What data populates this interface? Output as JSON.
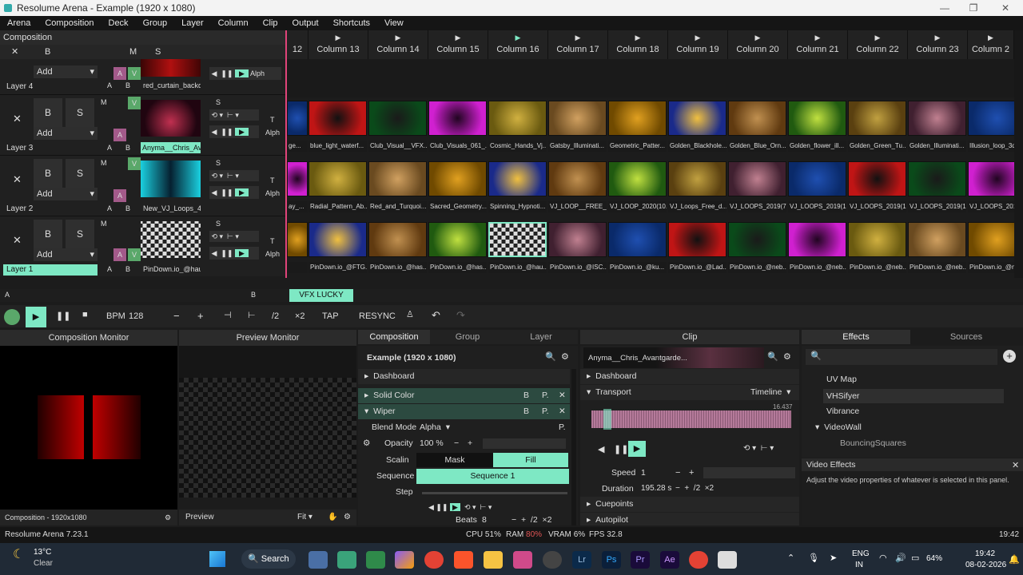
{
  "window": {
    "title": "Resolume Arena - Example (1920 x 1080)"
  },
  "menu": [
    "Arena",
    "Composition",
    "Deck",
    "Group",
    "Layer",
    "Column",
    "Clip",
    "Output",
    "Shortcuts",
    "View"
  ],
  "composition_label": "Composition",
  "columns": [
    "12",
    "Column 13",
    "Column 14",
    "Column 15",
    "Column 16",
    "Column 17",
    "Column 18",
    "Column 19",
    "Column 20",
    "Column 21",
    "Column 22",
    "Column 23",
    "Column 2"
  ],
  "layers": [
    {
      "name": "Layer 4",
      "clip": "red_curtain_backd...",
      "add": "Add"
    },
    {
      "name": "Layer 3",
      "clip": "Anyma__Chris_Av...",
      "add": "Add"
    },
    {
      "name": "Layer 2",
      "clip": "New_VJ_Loops_4K_...",
      "add": "Add"
    },
    {
      "name": "Layer 1",
      "clip": "PinDown.io_@hau...",
      "add": "Add"
    }
  ],
  "layer_letters": {
    "a": "A",
    "b": "B",
    "s": "S",
    "m": "M",
    "v": "V",
    "t": "T",
    "alph": "Alph",
    "x": "✕"
  },
  "clips_row3": [
    "ge...",
    "blue_light_waterf...",
    "Club_Visual__VFX...",
    "Club_Visuals_061_...",
    "Cosmic_Hands_Vj...",
    "Gatsby_Illuminati...",
    "Geometric_Patter...",
    "Golden_Blackhole...",
    "Golden_Blue_Orn...",
    "Golden_flower_ill...",
    "Golden_Green_Tu...",
    "Golden_Illuminati...",
    "Illusion_loop_3d"
  ],
  "clips_row2": [
    "ay_...",
    "Radial_Pattern_Ab...",
    "Red_and_Turquoi...",
    "Sacred_Geometry...",
    "Spinning_Hypnoti...",
    "VJ_LOOP__FREE_...",
    "VJ_LOOP_2020(10...",
    "VJ_Loops_Free_d...",
    "VJ_LOOPS_2019(7...",
    "VJ_LOOPS_2019(1...",
    "VJ_LOOPS_2019(1...",
    "VJ_LOOPS_2019(1...",
    "VJ_LOOPS_2019(1"
  ],
  "clips_row1": [
    "",
    "PinDown.io_@FTG...",
    "PinDown.io_@has...",
    "PinDown.io_@has...",
    "PinDown.io_@hau...",
    "PinDown.io_@ISC...",
    "PinDown.io_@ku...",
    "PinDown.io_@Lad...",
    "PinDown.io_@neb...",
    "PinDown.io_@neb...",
    "PinDown.io_@neb...",
    "PinDown.io_@neb...",
    "PinDown.io_@neb"
  ],
  "deck": {
    "name": "VFX LUCKY",
    "a": "A",
    "b": "B"
  },
  "transport": {
    "bpm_label": "BPM",
    "bpm": "128",
    "minus": "−",
    "plus": "+",
    "half": "/2",
    "double": "×2",
    "tap": "TAP",
    "resync": "RESYNC"
  },
  "comp_monitor": {
    "title": "Composition Monitor",
    "footer": "Composition - 1920x1080"
  },
  "preview_monitor": {
    "title": "Preview Monitor",
    "footer": "Preview",
    "fit": "Fit"
  },
  "comp_panel": {
    "tabs": [
      "Composition",
      "Group",
      "Layer"
    ],
    "title": "Example (1920 x 1080)",
    "dashboard": "Dashboard",
    "effects": [
      "Solid Color",
      "Wiper"
    ],
    "blend_label": "Blend Mode",
    "blend_value": "Alpha",
    "opacity_label": "Opacity",
    "opacity_value": "100 %",
    "scaling_label": "Scalin",
    "mask": "Mask",
    "fill": "Fill",
    "sequence_label": "Sequence",
    "sequence_value": "Sequence 1",
    "step_label": "Step",
    "beats_label": "Beats",
    "beats_value": "8"
  },
  "clip_panel": {
    "tab": "Clip",
    "name": "Anyma__Chris_Avantgarde...",
    "dashboard": "Dashboard",
    "transport": "Transport",
    "timeline": "Timeline",
    "time": "16.437",
    "speed_label": "Speed",
    "speed_value": "1",
    "duration_label": "Duration",
    "duration_value": "195.28 s",
    "cuepoints": "Cuepoints",
    "autopilot": "Autopilot"
  },
  "effects_panel": {
    "tabs": [
      "Effects",
      "Sources"
    ],
    "items": [
      "UV Map",
      "VHSifyer",
      "Vibrance",
      "VideoWall",
      "BouncingSquares"
    ],
    "info_title": "Video Effects",
    "info_text": "Adjust the video properties of whatever is selected in this panel."
  },
  "status": {
    "version": "Resolume Arena 7.23.1",
    "cpu_label": "CPU",
    "cpu": "51%",
    "ram_label": "RAM",
    "ram": "80%",
    "vram_label": "VRAM",
    "vram": "6%",
    "fps_label": "FPS",
    "fps": "32.8",
    "time": "19:42"
  },
  "taskbar": {
    "temp": "13°C",
    "weather": "Clear",
    "search": "Search",
    "lang1": "ENG",
    "lang2": "IN",
    "battery": "64%",
    "clock": "19:42",
    "date": "08-02-2026"
  },
  "colors": {
    "accent": "#7ee8c4",
    "bg": "#1c1c1c",
    "ram_warn": "#e05555"
  }
}
